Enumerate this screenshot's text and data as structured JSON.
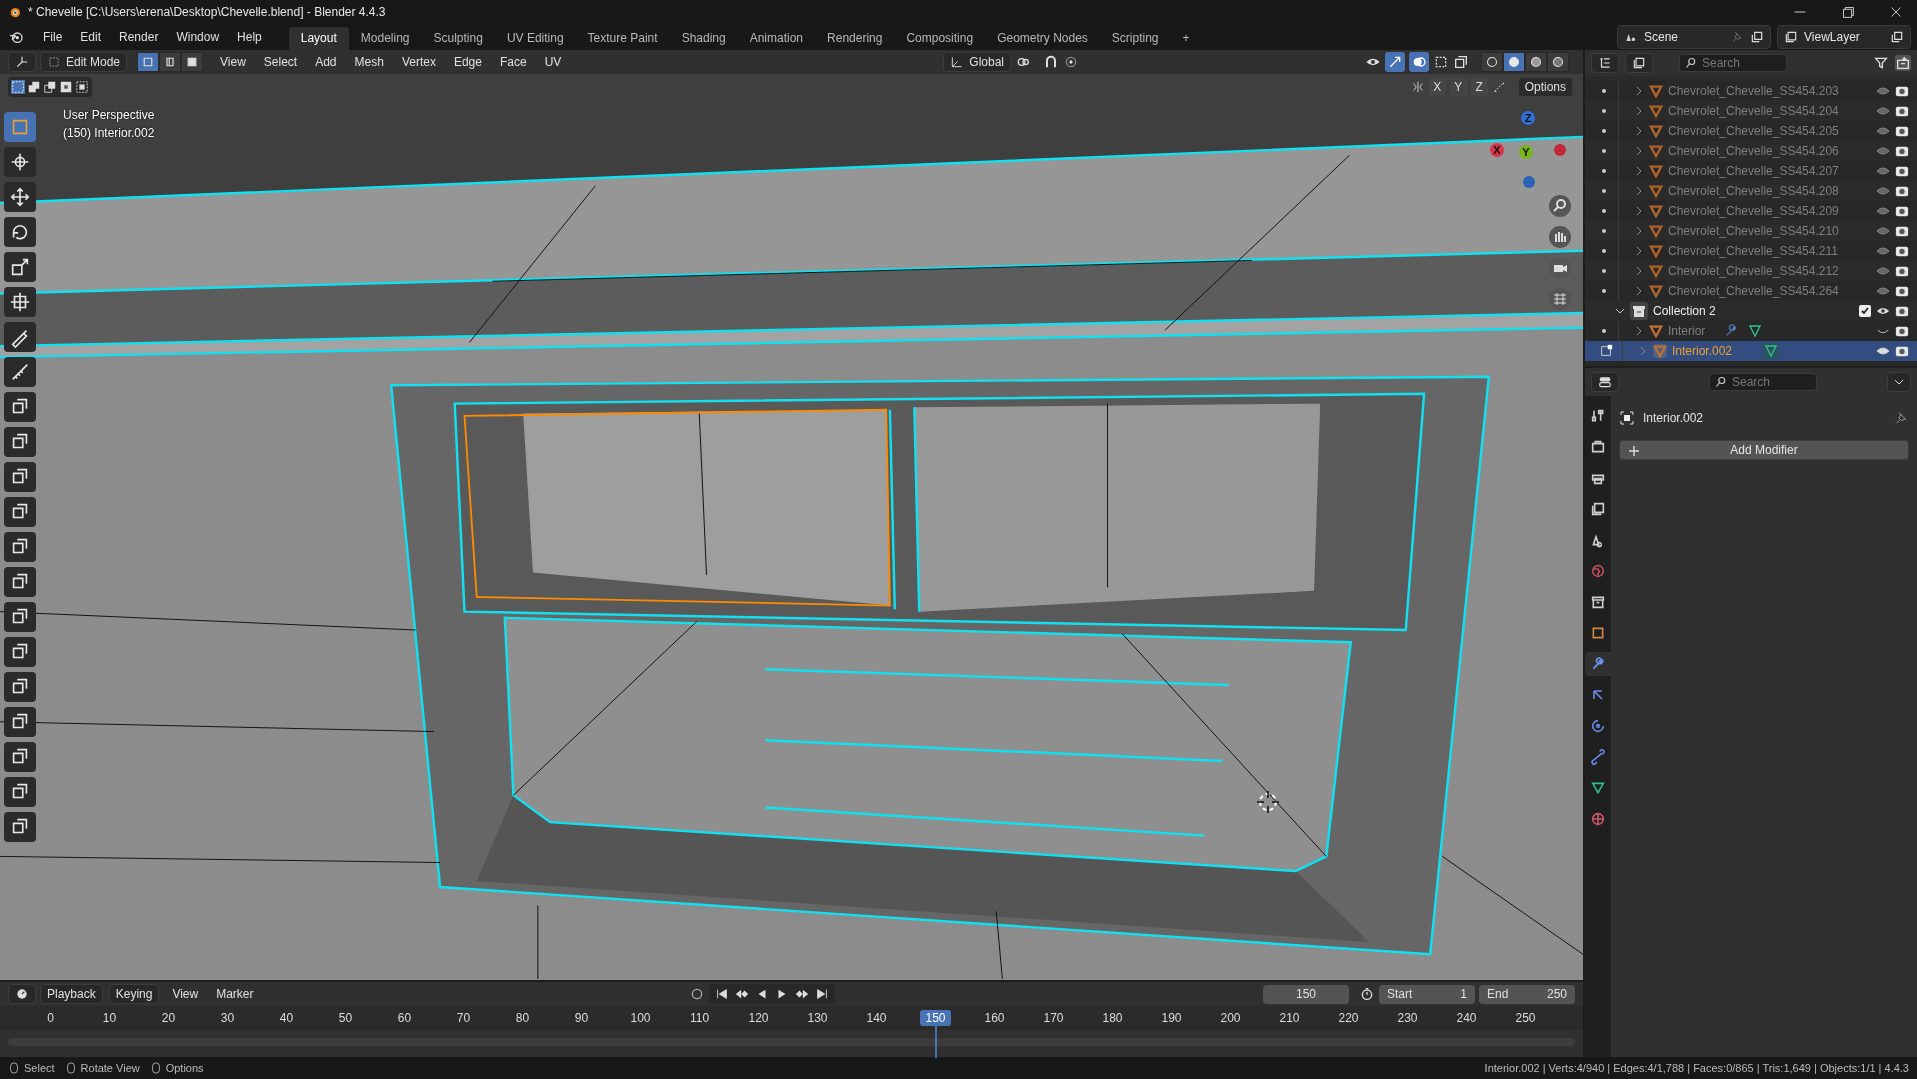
{
  "window": {
    "title": "* Chevelle [C:\\Users\\erena\\Desktop\\Chevelle.blend] - Blender 4.4.3"
  },
  "menu": [
    "File",
    "Edit",
    "Render",
    "Window",
    "Help"
  ],
  "workspaces": [
    {
      "label": "Layout",
      "selected": true
    },
    {
      "label": "Modeling",
      "selected": false
    },
    {
      "label": "Sculpting",
      "selected": false
    },
    {
      "label": "UV Editing",
      "selected": false
    },
    {
      "label": "Texture Paint",
      "selected": false
    },
    {
      "label": "Shading",
      "selected": false
    },
    {
      "label": "Animation",
      "selected": false
    },
    {
      "label": "Rendering",
      "selected": false
    },
    {
      "label": "Compositing",
      "selected": false
    },
    {
      "label": "Geometry Nodes",
      "selected": false
    },
    {
      "label": "Scripting",
      "selected": false
    }
  ],
  "add_workspace": "+",
  "scene": "Scene",
  "view_layer": "ViewLayer",
  "viewport_header": {
    "mode": "Edit Mode",
    "select_modes": [
      {
        "kind": "vertex",
        "selected": true
      },
      {
        "kind": "edge",
        "selected": false
      },
      {
        "kind": "face",
        "selected": false
      }
    ],
    "menus": [
      "View",
      "Select",
      "Add",
      "Mesh",
      "Vertex",
      "Edge",
      "Face",
      "UV"
    ],
    "orientation": "Global",
    "shading": [
      {
        "kind": "wireframe",
        "selected": false
      },
      {
        "kind": "solid",
        "selected": true
      },
      {
        "kind": "material",
        "selected": false
      },
      {
        "kind": "rendered",
        "selected": false
      }
    ]
  },
  "tool_settings": {
    "axes": [
      "X",
      "Y",
      "Z"
    ],
    "options": "Options"
  },
  "viewport": {
    "view_name": "User Perspective",
    "object_label": "(150) Interior.002"
  },
  "gizmo": {
    "x": "X",
    "y": "Y",
    "z": "Z"
  },
  "tools": [
    {
      "kind": "select",
      "selected": true
    },
    {
      "kind": "cursor",
      "selected": false
    },
    {
      "kind": "move",
      "selected": false
    },
    {
      "kind": "rotate",
      "selected": false
    },
    {
      "kind": "scale",
      "selected": false
    },
    {
      "kind": "transform",
      "selected": false
    },
    {
      "kind": "annotate",
      "selected": false
    },
    {
      "kind": "measure",
      "selected": false
    },
    {
      "kind": "add",
      "selected": false
    },
    {
      "kind": "extrude",
      "selected": false
    },
    {
      "kind": "inset",
      "selected": false
    },
    {
      "kind": "bevel",
      "selected": false
    },
    {
      "kind": "loopcut",
      "selected": false
    },
    {
      "kind": "knife",
      "selected": false
    },
    {
      "kind": "polybuild",
      "selected": false
    },
    {
      "kind": "spin",
      "selected": false
    },
    {
      "kind": "smooth",
      "selected": false
    },
    {
      "kind": "slide",
      "selected": false
    },
    {
      "kind": "shrink",
      "selected": false
    },
    {
      "kind": "shear",
      "selected": false
    },
    {
      "kind": "rip",
      "selected": false
    }
  ],
  "outliner": {
    "search_placeholder": "Search",
    "items": [
      {
        "name": "Chevrolet_Chevelle_SS454.203",
        "selected": false,
        "hidden": false,
        "modifier": false
      },
      {
        "name": "Chevrolet_Chevelle_SS454.204",
        "selected": false,
        "hidden": false,
        "modifier": false
      },
      {
        "name": "Chevrolet_Chevelle_SS454.205",
        "selected": false,
        "hidden": false,
        "modifier": false
      },
      {
        "name": "Chevrolet_Chevelle_SS454.206",
        "selected": false,
        "hidden": false,
        "modifier": false
      },
      {
        "name": "Chevrolet_Chevelle_SS454.207",
        "selected": false,
        "hidden": false,
        "modifier": false
      },
      {
        "name": "Chevrolet_Chevelle_SS454.208",
        "selected": false,
        "hidden": false,
        "modifier": false
      },
      {
        "name": "Chevrolet_Chevelle_SS454.209",
        "selected": false,
        "hidden": false,
        "modifier": false
      },
      {
        "name": "Chevrolet_Chevelle_SS454.210",
        "selected": false,
        "hidden": false,
        "modifier": false
      },
      {
        "name": "Chevrolet_Chevelle_SS454.211",
        "selected": false,
        "hidden": false,
        "modifier": false
      },
      {
        "name": "Chevrolet_Chevelle_SS454.212",
        "selected": false,
        "hidden": false,
        "modifier": false
      },
      {
        "name": "Chevrolet_Chevelle_SS454.264",
        "selected": false,
        "hidden": false,
        "modifier": false
      }
    ],
    "collection": {
      "name": "Collection 2",
      "expanded": true,
      "checked": true,
      "children": [
        {
          "name": "Interior",
          "selected": false,
          "hidden": true,
          "modifier": true
        },
        {
          "name": "Interior.002",
          "selected": true,
          "hidden": false,
          "modifier": false
        }
      ]
    }
  },
  "properties": {
    "search_placeholder": "Search",
    "object_name": "Interior.002",
    "add_modifier": "Add Modifier",
    "tabs": [
      {
        "kind": "tool",
        "selected": false
      },
      {
        "kind": "render",
        "selected": false
      },
      {
        "kind": "output",
        "selected": false
      },
      {
        "kind": "view_layer",
        "selected": false
      },
      {
        "kind": "scene",
        "selected": false
      },
      {
        "kind": "world",
        "selected": false
      },
      {
        "kind": "collection",
        "selected": false
      },
      {
        "kind": "object",
        "selected": false
      },
      {
        "kind": "modifiers",
        "selected": true
      },
      {
        "kind": "particles",
        "selected": false
      },
      {
        "kind": "physics",
        "selected": false
      },
      {
        "kind": "constraints",
        "selected": false
      },
      {
        "kind": "data",
        "selected": false
      },
      {
        "kind": "material",
        "selected": false
      }
    ]
  },
  "timeline": {
    "menus": [
      "Playback",
      "Keying",
      "View",
      "Marker"
    ],
    "current_frame": "150",
    "start_label": "Start",
    "start": "1",
    "end_label": "End",
    "end": "250",
    "ticks": [
      {
        "label": "0",
        "selected": false
      },
      {
        "label": "10",
        "selected": false
      },
      {
        "label": "20",
        "selected": false
      },
      {
        "label": "30",
        "selected": false
      },
      {
        "label": "40",
        "selected": false
      },
      {
        "label": "50",
        "selected": false
      },
      {
        "label": "60",
        "selected": false
      },
      {
        "label": "70",
        "selected": false
      },
      {
        "label": "80",
        "selected": false
      },
      {
        "label": "90",
        "selected": false
      },
      {
        "label": "100",
        "selected": false
      },
      {
        "label": "110",
        "selected": false
      },
      {
        "label": "120",
        "selected": false
      },
      {
        "label": "130",
        "selected": false
      },
      {
        "label": "140",
        "selected": false
      },
      {
        "label": "150",
        "selected": true
      },
      {
        "label": "160",
        "selected": false
      },
      {
        "label": "170",
        "selected": false
      },
      {
        "label": "180",
        "selected": false
      },
      {
        "label": "190",
        "selected": false
      },
      {
        "label": "200",
        "selected": false
      },
      {
        "label": "210",
        "selected": false
      },
      {
        "label": "220",
        "selected": false
      },
      {
        "label": "230",
        "selected": false
      },
      {
        "label": "240",
        "selected": false
      },
      {
        "label": "250",
        "selected": false
      }
    ]
  },
  "status_bar": {
    "hints": [
      "Select",
      "Rotate View",
      "Options"
    ],
    "stats": "Interior.002 | Verts:4/940 | Edges:4/1,788 | Faces:0/865 | Tris:1,649 | Objects:1/1 | 4.4.3"
  }
}
